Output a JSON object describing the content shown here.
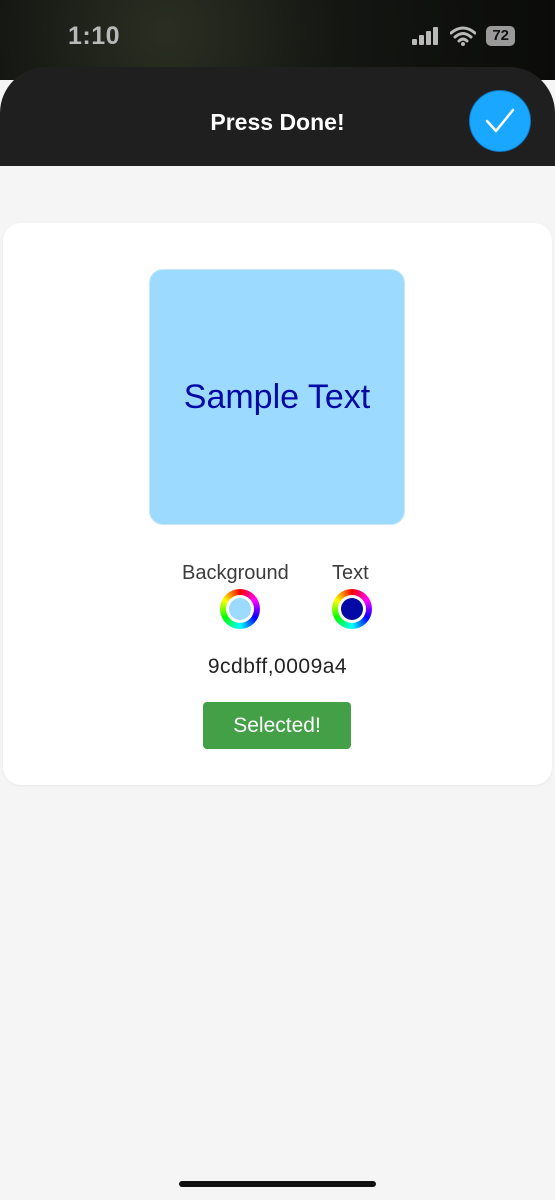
{
  "status_bar": {
    "time": "1:10",
    "battery": "72"
  },
  "header": {
    "title": "Press Done!",
    "done_icon": "checkmark-icon"
  },
  "preview": {
    "sample_text": "Sample Text",
    "background_color": "#9cdbff",
    "text_color": "#0009a4"
  },
  "pickers": {
    "background_label": "Background",
    "text_label": "Text"
  },
  "hex_readout": "9cdbff,0009a4",
  "selected_button_label": "Selected!",
  "colors": {
    "accent": "#1aa7ff",
    "success": "#43a047",
    "header_bg": "#1f1f20"
  }
}
